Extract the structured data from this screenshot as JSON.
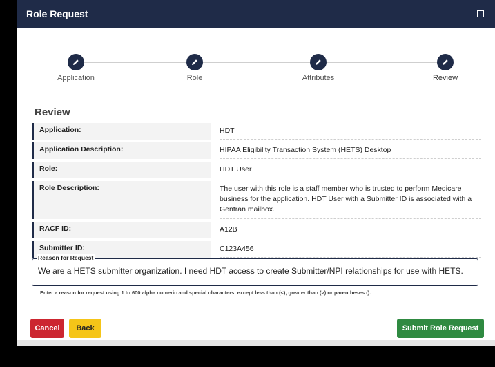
{
  "header": {
    "title": "Role Request"
  },
  "steps": [
    {
      "label": "Application"
    },
    {
      "label": "Role"
    },
    {
      "label": "Attributes"
    },
    {
      "label": "Review"
    }
  ],
  "review": {
    "title": "Review",
    "rows": [
      {
        "label": "Application:",
        "value": "HDT"
      },
      {
        "label": "Application Description:",
        "value": "HIPAA Eligibility Transaction System (HETS) Desktop"
      },
      {
        "label": "Role:",
        "value": "HDT User"
      },
      {
        "label": "Role Description:",
        "value": "The user with this role is a staff member who is trusted to perform Medicare business for the application. HDT User with a Submitter ID is associated with a Gentran mailbox."
      },
      {
        "label": "RACF ID:",
        "value": "A12B"
      },
      {
        "label": "Submitter ID:",
        "value": "C123A456"
      }
    ]
  },
  "reason": {
    "legend": "Reason for Request",
    "value": "We are a HETS submitter organization.  I need HDT access to create Submitter/NPI relationships for use with HETS.",
    "helper": "Enter a reason for request using 1 to 600 alpha numeric and special characters, except less than (<), greater than (>) or parentheses ()."
  },
  "buttons": {
    "cancel": "Cancel",
    "back": "Back",
    "submit": "Submit Role Request"
  },
  "colors": {
    "header": "#1f2b48",
    "cancel": "#cc2630",
    "back": "#f5c518",
    "submit": "#2f8a41"
  },
  "icons": {
    "step": "pencil-icon",
    "header": "expand-icon"
  }
}
